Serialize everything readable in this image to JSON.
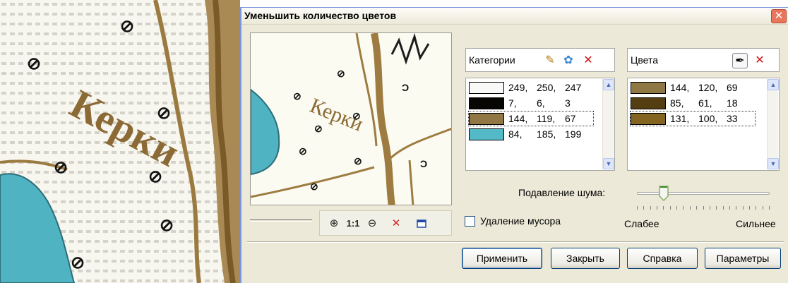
{
  "background_map": {
    "place_label": "Керки"
  },
  "dialog": {
    "title": "Уменьшить количество цветов",
    "close_glyph": "✕"
  },
  "preview": {
    "place_label": "Керки",
    "zoom_toolbar": {
      "zoom_in_icon": "zoom-in-icon",
      "actual_size_label": "1:1",
      "zoom_out_icon": "zoom-out-icon",
      "clear_icon": "close-icon",
      "window_icon": "window-icon"
    }
  },
  "categories": {
    "label": "Категории",
    "icons": [
      "edit-pencil-icon",
      "palette-icon",
      "delete-icon"
    ],
    "rows": [
      {
        "color": "#f9faf7",
        "r": "249,",
        "g": "250,",
        "b": "247"
      },
      {
        "color": "#070603",
        "r": "7,",
        "g": "6,",
        "b": "3"
      },
      {
        "color": "#907743",
        "r": "144,",
        "g": "119,",
        "b": "67",
        "selected": true
      },
      {
        "color": "#54b9c7",
        "r": "84,",
        "g": "185,",
        "b": "199"
      }
    ]
  },
  "colors": {
    "label": "Цвета",
    "icons": [
      "eyedropper-icon",
      "delete-icon"
    ],
    "rows": [
      {
        "color": "#907845",
        "r": "144,",
        "g": "120,",
        "b": "69"
      },
      {
        "color": "#553d12",
        "r": "85,",
        "g": "61,",
        "b": "18"
      },
      {
        "color": "#836421",
        "r": "131,",
        "g": "100,",
        "b": "33",
        "selected": true
      }
    ]
  },
  "noise": {
    "label": "Подавление шума:",
    "level": 0.2,
    "weak_label": "Слабее",
    "strong_label": "Сильнее"
  },
  "garbage_removal": {
    "label": "Удаление мусора",
    "checked": false
  },
  "buttons": {
    "apply": "Применить",
    "close": "Закрыть",
    "help": "Справка",
    "params": "Параметры"
  },
  "colors_theme": {
    "title_bar": "#ece9d8",
    "dialog_bg": "#ece9d8",
    "close_button": "#e8765c",
    "map_brown": "#9a7b45",
    "map_water": "#4fb4c4"
  }
}
